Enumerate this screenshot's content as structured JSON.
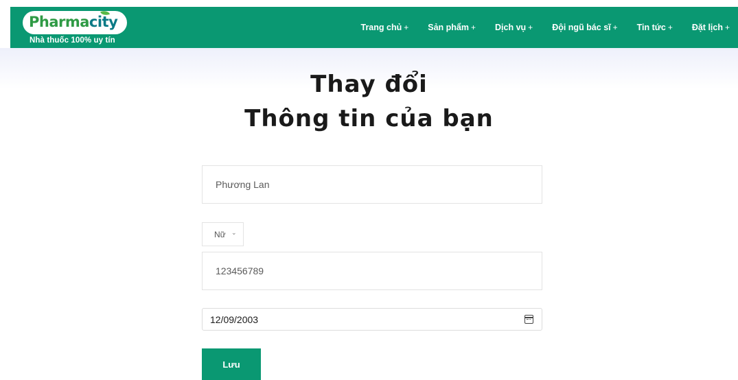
{
  "brand": {
    "name_part1": "Pharma",
    "name_part2": "city",
    "tagline": "Nhà thuốc 100% uy tín",
    "color_primary": "#0a9872",
    "color_logo_green": "#2f9a45",
    "color_logo_teal": "#0a7a86"
  },
  "nav": {
    "items": [
      {
        "label": "Trang chủ",
        "suffix": "+"
      },
      {
        "label": "Sản phẩm",
        "suffix": "+"
      },
      {
        "label": "Dịch vụ",
        "suffix": "+"
      },
      {
        "label": "Đội ngũ bác sĩ",
        "suffix": "+"
      },
      {
        "label": "Tin tức",
        "suffix": "+"
      },
      {
        "label": "Đặt lịch",
        "suffix": "+"
      }
    ]
  },
  "page": {
    "title_line1": "Thay đổi",
    "title_line2": "Thông tin của bạn"
  },
  "form": {
    "name_value": "Phương Lan",
    "gender_value": "Nữ",
    "gender_chevron": "⌄",
    "phone_value": "123456789",
    "dob_value": "12/09/2003",
    "save_label": "Lưu"
  }
}
